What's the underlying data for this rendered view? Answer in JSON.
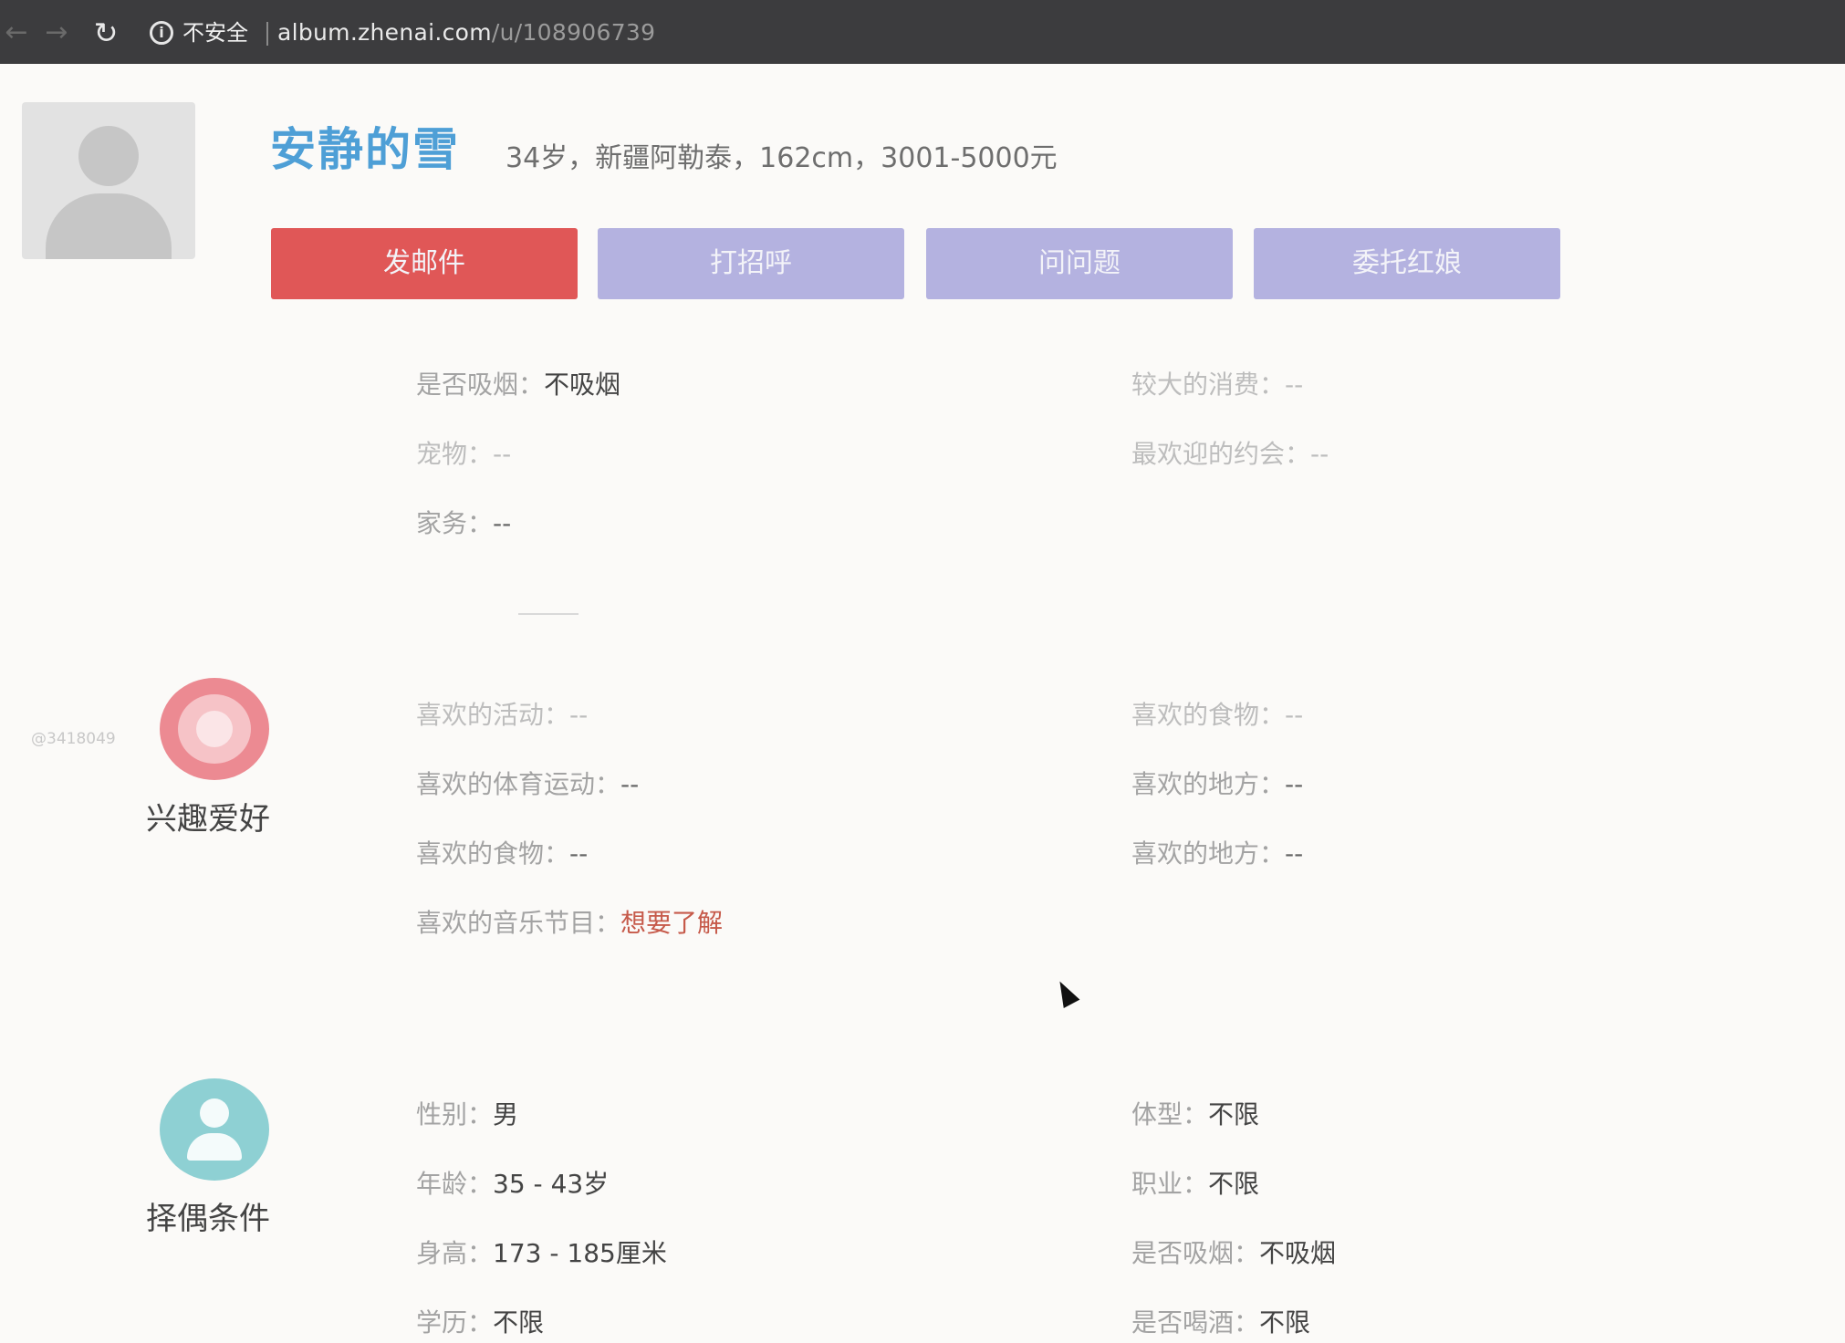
{
  "browser": {
    "back_icon": "←",
    "forward_icon": "→",
    "reload_icon": "↻",
    "info_icon": "i",
    "security_label": "不安全",
    "url_domain": "album.zhenai.com",
    "url_path": "/u/108906739"
  },
  "profile": {
    "nickname": "安静的雪",
    "basic_info": "34岁，新疆阿勒泰，162cm，3001-5000元"
  },
  "actions": {
    "mail": "发邮件",
    "greet": "打招呼",
    "ask": "问问题",
    "matchmaker": "委托红娘"
  },
  "lifestyle": {
    "left": [
      {
        "label": "是否吸烟",
        "value": "不吸烟"
      },
      {
        "label": "宠物",
        "value": "--"
      },
      {
        "label": "家务",
        "value": "--"
      }
    ],
    "right": [
      {
        "label": "较大的消费",
        "value": "--"
      },
      {
        "label": "最欢迎的约会",
        "value": "--"
      }
    ]
  },
  "hobbies": {
    "title": "兴趣爱好",
    "watermark": "@3418049",
    "left": [
      {
        "label": "喜欢的活动",
        "value": "--"
      },
      {
        "label": "喜欢的体育运动",
        "value": "--"
      },
      {
        "label": "喜欢的食物",
        "value": "--"
      },
      {
        "label": "喜欢的音乐节目",
        "value": "想要了解"
      }
    ],
    "right": [
      {
        "label": "喜欢的食物",
        "value": "--"
      },
      {
        "label": "喜欢的地方",
        "value": "--"
      },
      {
        "label": "喜欢的地方",
        "value": "--"
      }
    ]
  },
  "partner": {
    "title": "择偶条件",
    "left": [
      {
        "label": "性别",
        "value": "男"
      },
      {
        "label": "年龄",
        "value": "35 - 43岁"
      },
      {
        "label": "身高",
        "value": "173 - 185厘米"
      },
      {
        "label": "学历",
        "value": "不限"
      }
    ],
    "right": [
      {
        "label": "体型",
        "value": "不限"
      },
      {
        "label": "职业",
        "value": "不限"
      },
      {
        "label": "是否吸烟",
        "value": "不吸烟"
      },
      {
        "label": "是否喝酒",
        "value": "不限"
      }
    ]
  },
  "separator": "："
}
